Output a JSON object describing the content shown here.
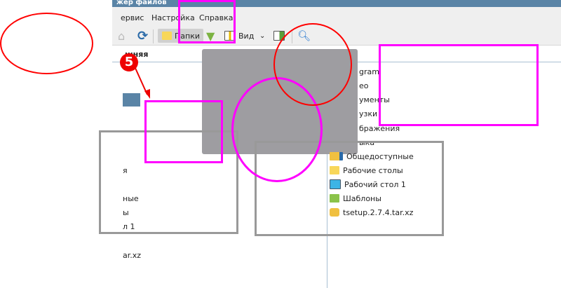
{
  "window": {
    "title": "жер файлов"
  },
  "menu": [
    "ервис",
    "Настройка",
    "Справка"
  ],
  "toolbar": {
    "folders_label": "Папки",
    "view_label": "Вид"
  },
  "header": {
    "column": "шняя"
  },
  "left_list": [
    "я",
    "ные",
    "ы",
    "л 1",
    "ar.xz"
  ],
  "right_list": [
    {
      "label": "gram",
      "icon": "none"
    },
    {
      "label": "ео",
      "icon": "none"
    },
    {
      "label": "ументы",
      "icon": "none"
    },
    {
      "label": "узки",
      "icon": "none"
    },
    {
      "label": "бражения",
      "icon": "none"
    },
    {
      "label": "ыка",
      "icon": "none"
    },
    {
      "label": "Общедоступные",
      "icon": "public-folder-icon"
    },
    {
      "label": "Рабочие столы",
      "icon": "folder-icon"
    },
    {
      "label": "Рабочий стол 1",
      "icon": "desktop-icon"
    },
    {
      "label": "Шаблоны",
      "icon": "templates-folder-icon"
    },
    {
      "label": "tsetup.2.7.4.tar.xz",
      "icon": "archive-icon"
    }
  ],
  "annotation": {
    "step": "5"
  },
  "colors": {
    "accent": "#5a84a6",
    "highlight": "#ff00ff",
    "circle": "#ff0000"
  }
}
